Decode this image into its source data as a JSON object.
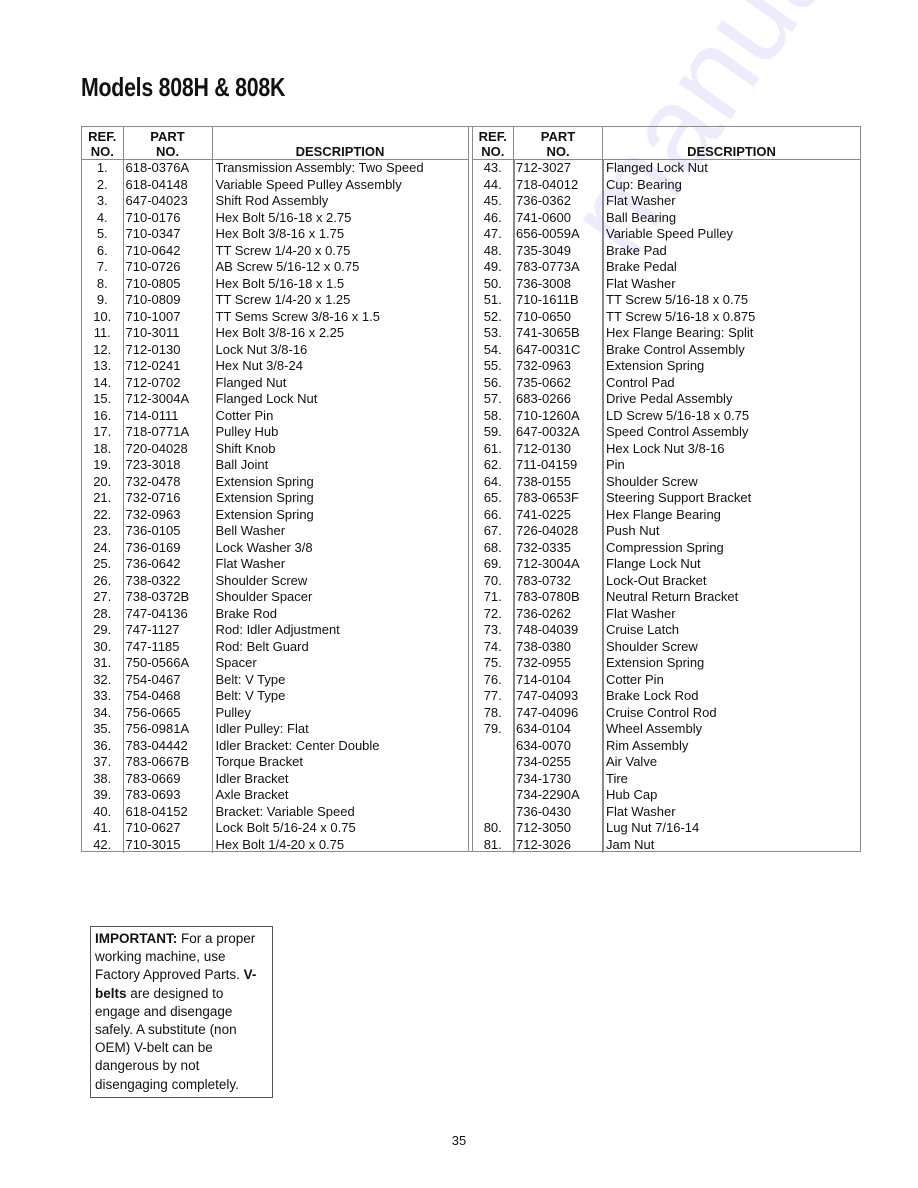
{
  "page": {
    "title": "Models 808H & 808K",
    "page_number": "35",
    "watermark": "manualshive.com"
  },
  "table": {
    "headers": {
      "ref_line1": "REF.",
      "ref_line2": "NO.",
      "part_line1": "PART",
      "part_line2": "NO.",
      "description": "DESCRIPTION"
    },
    "left": [
      {
        "ref": "1.",
        "part": "618-0376A",
        "desc": "Transmission Assembly: Two Speed"
      },
      {
        "ref": "2.",
        "part": "618-04148",
        "desc": "Variable Speed Pulley Assembly"
      },
      {
        "ref": "3.",
        "part": "647-04023",
        "desc": "Shift Rod Assembly"
      },
      {
        "ref": "4.",
        "part": "710-0176",
        "desc": "Hex Bolt 5/16-18 x 2.75"
      },
      {
        "ref": "5.",
        "part": "710-0347",
        "desc": "Hex Bolt 3/8-16 x 1.75"
      },
      {
        "ref": "6.",
        "part": "710-0642",
        "desc": "TT Screw 1/4-20 x 0.75"
      },
      {
        "ref": "7.",
        "part": "710-0726",
        "desc": "AB Screw 5/16-12 x 0.75"
      },
      {
        "ref": "8.",
        "part": "710-0805",
        "desc": "Hex Bolt 5/16-18 x 1.5"
      },
      {
        "ref": "9.",
        "part": "710-0809",
        "desc": "TT Screw 1/4-20 x 1.25"
      },
      {
        "ref": "10.",
        "part": "710-1007",
        "desc": "TT Sems Screw 3/8-16 x 1.5"
      },
      {
        "ref": "11.",
        "part": "710-3011",
        "desc": "Hex Bolt 3/8-16 x 2.25"
      },
      {
        "ref": "12.",
        "part": "712-0130",
        "desc": "Lock Nut 3/8-16"
      },
      {
        "ref": "13.",
        "part": "712-0241",
        "desc": "Hex Nut 3/8-24"
      },
      {
        "ref": "14.",
        "part": "712-0702",
        "desc": "Flanged Nut"
      },
      {
        "ref": "15.",
        "part": "712-3004A",
        "desc": "Flanged Lock Nut"
      },
      {
        "ref": "16.",
        "part": "714-0111",
        "desc": "Cotter Pin"
      },
      {
        "ref": "17.",
        "part": "718-0771A",
        "desc": "Pulley Hub"
      },
      {
        "ref": "18.",
        "part": "720-04028",
        "desc": "Shift Knob"
      },
      {
        "ref": "19.",
        "part": "723-3018",
        "desc": "Ball Joint"
      },
      {
        "ref": "20.",
        "part": "732-0478",
        "desc": "Extension Spring"
      },
      {
        "ref": "21.",
        "part": "732-0716",
        "desc": "Extension Spring"
      },
      {
        "ref": "22.",
        "part": "732-0963",
        "desc": "Extension Spring"
      },
      {
        "ref": "23.",
        "part": "736-0105",
        "desc": "Bell Washer"
      },
      {
        "ref": "24.",
        "part": "736-0169",
        "desc": "Lock Washer 3/8"
      },
      {
        "ref": "25.",
        "part": "736-0642",
        "desc": "Flat Washer"
      },
      {
        "ref": "26.",
        "part": "738-0322",
        "desc": "Shoulder Screw"
      },
      {
        "ref": "27.",
        "part": "738-0372B",
        "desc": "Shoulder Spacer"
      },
      {
        "ref": "28.",
        "part": "747-04136",
        "desc": "Brake Rod"
      },
      {
        "ref": "29.",
        "part": "747-1127",
        "desc": "Rod: Idler Adjustment"
      },
      {
        "ref": "30.",
        "part": "747-1185",
        "desc": "Rod: Belt Guard"
      },
      {
        "ref": "31.",
        "part": "750-0566A",
        "desc": "Spacer"
      },
      {
        "ref": "32.",
        "part": "754-0467",
        "desc": "Belt: V Type"
      },
      {
        "ref": "33.",
        "part": "754-0468",
        "desc": "Belt: V Type"
      },
      {
        "ref": "34.",
        "part": "756-0665",
        "desc": "Pulley"
      },
      {
        "ref": "35.",
        "part": "756-0981A",
        "desc": "Idler Pulley: Flat"
      },
      {
        "ref": "36.",
        "part": "783-04442",
        "desc": "Idler Bracket: Center Double"
      },
      {
        "ref": "37.",
        "part": "783-0667B",
        "desc": "Torque Bracket"
      },
      {
        "ref": "38.",
        "part": "783-0669",
        "desc": "Idler Bracket"
      },
      {
        "ref": "39.",
        "part": "783-0693",
        "desc": "Axle Bracket"
      },
      {
        "ref": "40.",
        "part": "618-04152",
        "desc": "Bracket: Variable Speed"
      },
      {
        "ref": "41.",
        "part": "710-0627",
        "desc": "Lock Bolt 5/16-24 x 0.75"
      },
      {
        "ref": "42.",
        "part": "710-3015",
        "desc": "Hex Bolt 1/4-20 x 0.75"
      }
    ],
    "right": [
      {
        "ref": "43.",
        "part": "712-3027",
        "desc": "Flanged Lock Nut"
      },
      {
        "ref": "44.",
        "part": "718-04012",
        "desc": "Cup: Bearing"
      },
      {
        "ref": "45.",
        "part": "736-0362",
        "desc": "Flat Washer"
      },
      {
        "ref": "46.",
        "part": "741-0600",
        "desc": "Ball Bearing"
      },
      {
        "ref": "47.",
        "part": "656-0059A",
        "desc": "Variable Speed Pulley"
      },
      {
        "ref": "48.",
        "part": "735-3049",
        "desc": "Brake Pad"
      },
      {
        "ref": "49.",
        "part": "783-0773A",
        "desc": "Brake Pedal"
      },
      {
        "ref": "50.",
        "part": "736-3008",
        "desc": "Flat Washer"
      },
      {
        "ref": "51.",
        "part": "710-1611B",
        "desc": "TT Screw 5/16-18 x 0.75"
      },
      {
        "ref": "52.",
        "part": "710-0650",
        "desc": "TT Screw 5/16-18 x 0.875"
      },
      {
        "ref": "53.",
        "part": "741-3065B",
        "desc": "Hex Flange Bearing: Split"
      },
      {
        "ref": "54.",
        "part": "647-0031C",
        "desc": "Brake Control Assembly"
      },
      {
        "ref": "55.",
        "part": "732-0963",
        "desc": "Extension Spring"
      },
      {
        "ref": "56.",
        "part": "735-0662",
        "desc": "Control Pad"
      },
      {
        "ref": "57.",
        "part": "683-0266",
        "desc": "Drive Pedal Assembly"
      },
      {
        "ref": "58.",
        "part": "710-1260A",
        "desc": "LD Screw 5/16-18 x 0.75"
      },
      {
        "ref": "59.",
        "part": "647-0032A",
        "desc": "Speed Control Assembly"
      },
      {
        "ref": "61.",
        "part": "712-0130",
        "desc": "Hex Lock Nut 3/8-16"
      },
      {
        "ref": "62.",
        "part": "711-04159",
        "desc": "Pin"
      },
      {
        "ref": "64.",
        "part": "738-0155",
        "desc": "Shoulder Screw"
      },
      {
        "ref": "65.",
        "part": "783-0653F",
        "desc": "Steering Support Bracket"
      },
      {
        "ref": "66.",
        "part": "741-0225",
        "desc": "Hex Flange Bearing"
      },
      {
        "ref": "67.",
        "part": "726-04028",
        "desc": "Push Nut"
      },
      {
        "ref": "68.",
        "part": "732-0335",
        "desc": "Compression Spring"
      },
      {
        "ref": "69.",
        "part": "712-3004A",
        "desc": "Flange Lock Nut"
      },
      {
        "ref": "70.",
        "part": "783-0732",
        "desc": "Lock-Out Bracket"
      },
      {
        "ref": "71.",
        "part": "783-0780B",
        "desc": "Neutral Return Bracket"
      },
      {
        "ref": "72.",
        "part": "736-0262",
        "desc": "Flat Washer"
      },
      {
        "ref": "73.",
        "part": "748-04039",
        "desc": "Cruise Latch"
      },
      {
        "ref": "74.",
        "part": "738-0380",
        "desc": "Shoulder Screw"
      },
      {
        "ref": "75.",
        "part": "732-0955",
        "desc": "Extension Spring"
      },
      {
        "ref": "76.",
        "part": "714-0104",
        "desc": "Cotter Pin"
      },
      {
        "ref": "77.",
        "part": "747-04093",
        "desc": "Brake Lock Rod"
      },
      {
        "ref": "78.",
        "part": "747-04096",
        "desc": "Cruise Control Rod"
      },
      {
        "ref": "79.",
        "part": "634-0104",
        "desc": "Wheel Assembly"
      },
      {
        "ref": "",
        "part": "634-0070",
        "desc": "Rim Assembly"
      },
      {
        "ref": "",
        "part": "734-0255",
        "desc": "Air Valve"
      },
      {
        "ref": "",
        "part": "734-1730",
        "desc": "Tire"
      },
      {
        "ref": "",
        "part": "734-2290A",
        "desc": "Hub Cap"
      },
      {
        "ref": "",
        "part": "736-0430",
        "desc": "Flat Washer"
      },
      {
        "ref": "80.",
        "part": "712-3050",
        "desc": "Lug Nut 7/16-14"
      },
      {
        "ref": "81.",
        "part": "712-3026",
        "desc": "Jam Nut"
      }
    ]
  },
  "notice": {
    "label": "IMPORTANT:",
    "text1": " For a proper working machine, use Factory Approved Parts. ",
    "bold": "V-belts",
    "text2": " are designed to engage and disengage safely. A substitute (non OEM) V-belt can be dangerous by not disengaging completely."
  }
}
